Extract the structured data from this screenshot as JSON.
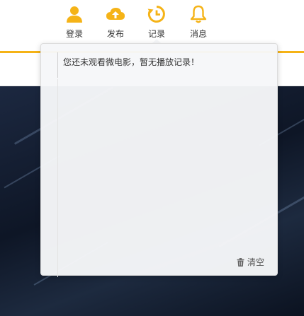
{
  "nav": {
    "items": [
      {
        "label": "登录",
        "icon": "user-icon"
      },
      {
        "label": "发布",
        "icon": "cloud-upload-icon"
      },
      {
        "label": "记录",
        "icon": "history-icon"
      },
      {
        "label": "消息",
        "icon": "bell-icon"
      }
    ]
  },
  "history_popup": {
    "empty_message": "您还未观看微电影，暂无播放记录！",
    "clear_label": "清空",
    "clear_icon": "trash-icon"
  },
  "colors": {
    "accent": "#f5b317",
    "text": "#333333"
  }
}
